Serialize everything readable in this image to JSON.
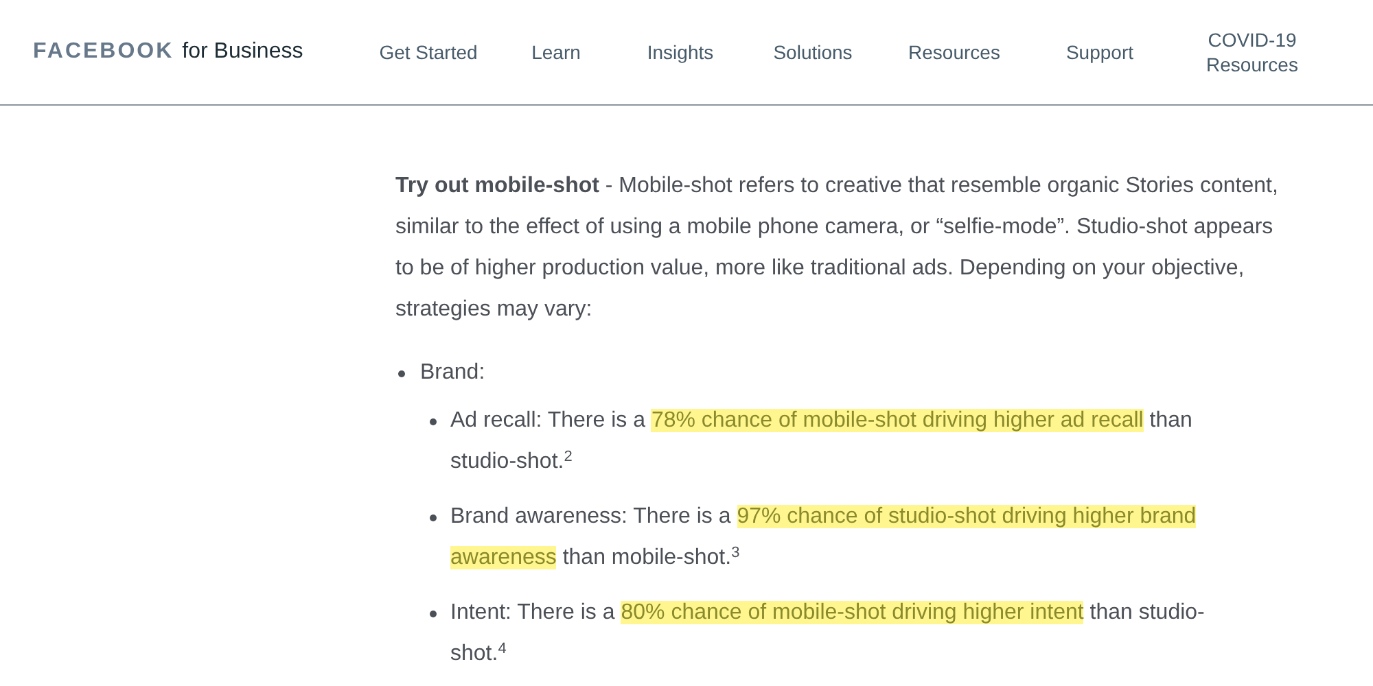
{
  "header": {
    "logo_brand": "FACEBOOK",
    "logo_suffix": "for Business",
    "nav": [
      {
        "label": "Get Started"
      },
      {
        "label": "Learn"
      },
      {
        "label": "Insights"
      },
      {
        "label": "Solutions"
      },
      {
        "label": "Resources"
      },
      {
        "label": "Support"
      },
      {
        "label": "COVID-19 Resources"
      }
    ]
  },
  "article": {
    "intro": "**Try out mobile-shot** - Mobile-shot refers to creative that resemble organic Stories content, similar to the effect of using a mobile phone camera, or “selfie-mode”. Studio-shot appears to be of higher production value, more like traditional ads. Depending on your objective, strategies may vary:",
    "list": [
      {
        "label": "Brand:",
        "children": [
          {
            "before": "Ad recall: There is a ",
            "highlight": "78% chance of mobile-shot driving higher ad recall",
            "after": " than studio-shot.$^{2}$"
          },
          {
            "before": "Brand awareness: There is a ",
            "highlight": "97% chance of studio-shot driving higher brand awareness",
            "after": " than mobile-shot.$^{3}$"
          },
          {
            "before": "Intent: There is a ",
            "highlight": "80% chance of mobile-shot driving higher intent",
            "after": " than studio-shot.$^{4}$"
          }
        ]
      }
    ]
  }
}
